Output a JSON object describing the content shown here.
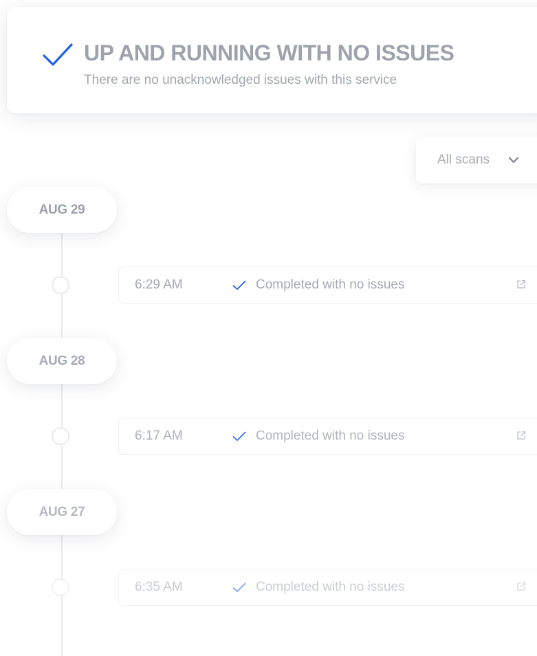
{
  "status": {
    "title": "UP AND RUNNING WITH NO ISSUES",
    "subtitle": "There are no unacknowledged issues with this service",
    "check_icon": "check-icon",
    "accent_color": "#1f5fe8"
  },
  "filter": {
    "selected": "All scans",
    "chevron_icon": "chevron-down-icon"
  },
  "timeline": [
    {
      "date": "AUG 29",
      "scan": {
        "time": "6:29 AM",
        "status": "Completed with no issues",
        "link_icon": "external-link-icon"
      }
    },
    {
      "date": "AUG 28",
      "scan": {
        "time": "6:17 AM",
        "status": "Completed with no issues",
        "link_icon": "external-link-icon"
      }
    },
    {
      "date": "AUG 27",
      "scan": {
        "time": "6:35 AM",
        "status": "Completed with no issues",
        "link_icon": "external-link-icon"
      }
    }
  ]
}
